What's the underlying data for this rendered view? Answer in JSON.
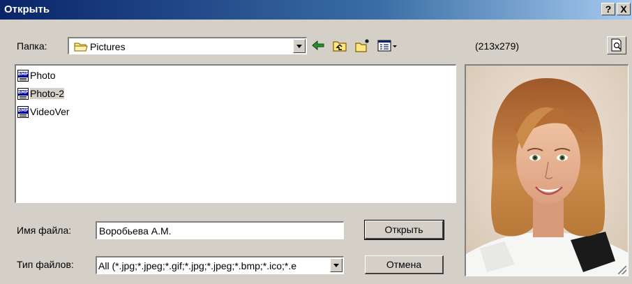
{
  "window": {
    "title": "Открыть",
    "help_label": "?",
    "close_label": "X"
  },
  "folder": {
    "label": "Папка:",
    "value": "Pictures"
  },
  "toolbar": {
    "icons": [
      "back-icon",
      "up-folder-icon",
      "new-folder-icon",
      "view-menu-icon"
    ]
  },
  "preview": {
    "dimensions": "(213x279)"
  },
  "files": [
    {
      "name": "Photo",
      "icon": "bmp-file-icon",
      "selected": false
    },
    {
      "name": "Photo-2",
      "icon": "bmp-file-icon",
      "selected": true
    },
    {
      "name": "VideoVer",
      "icon": "bmp-file-icon",
      "selected": false
    }
  ],
  "filename": {
    "label": "Имя файла:",
    "value": "Воробьева А.М."
  },
  "filetype": {
    "label": "Тип файлов:",
    "value": "All (*.jpg;*.jpeg;*.gif;*.jpg;*.jpeg;*.bmp;*.ico;*.e"
  },
  "buttons": {
    "open": "Открыть",
    "cancel": "Отмена"
  }
}
